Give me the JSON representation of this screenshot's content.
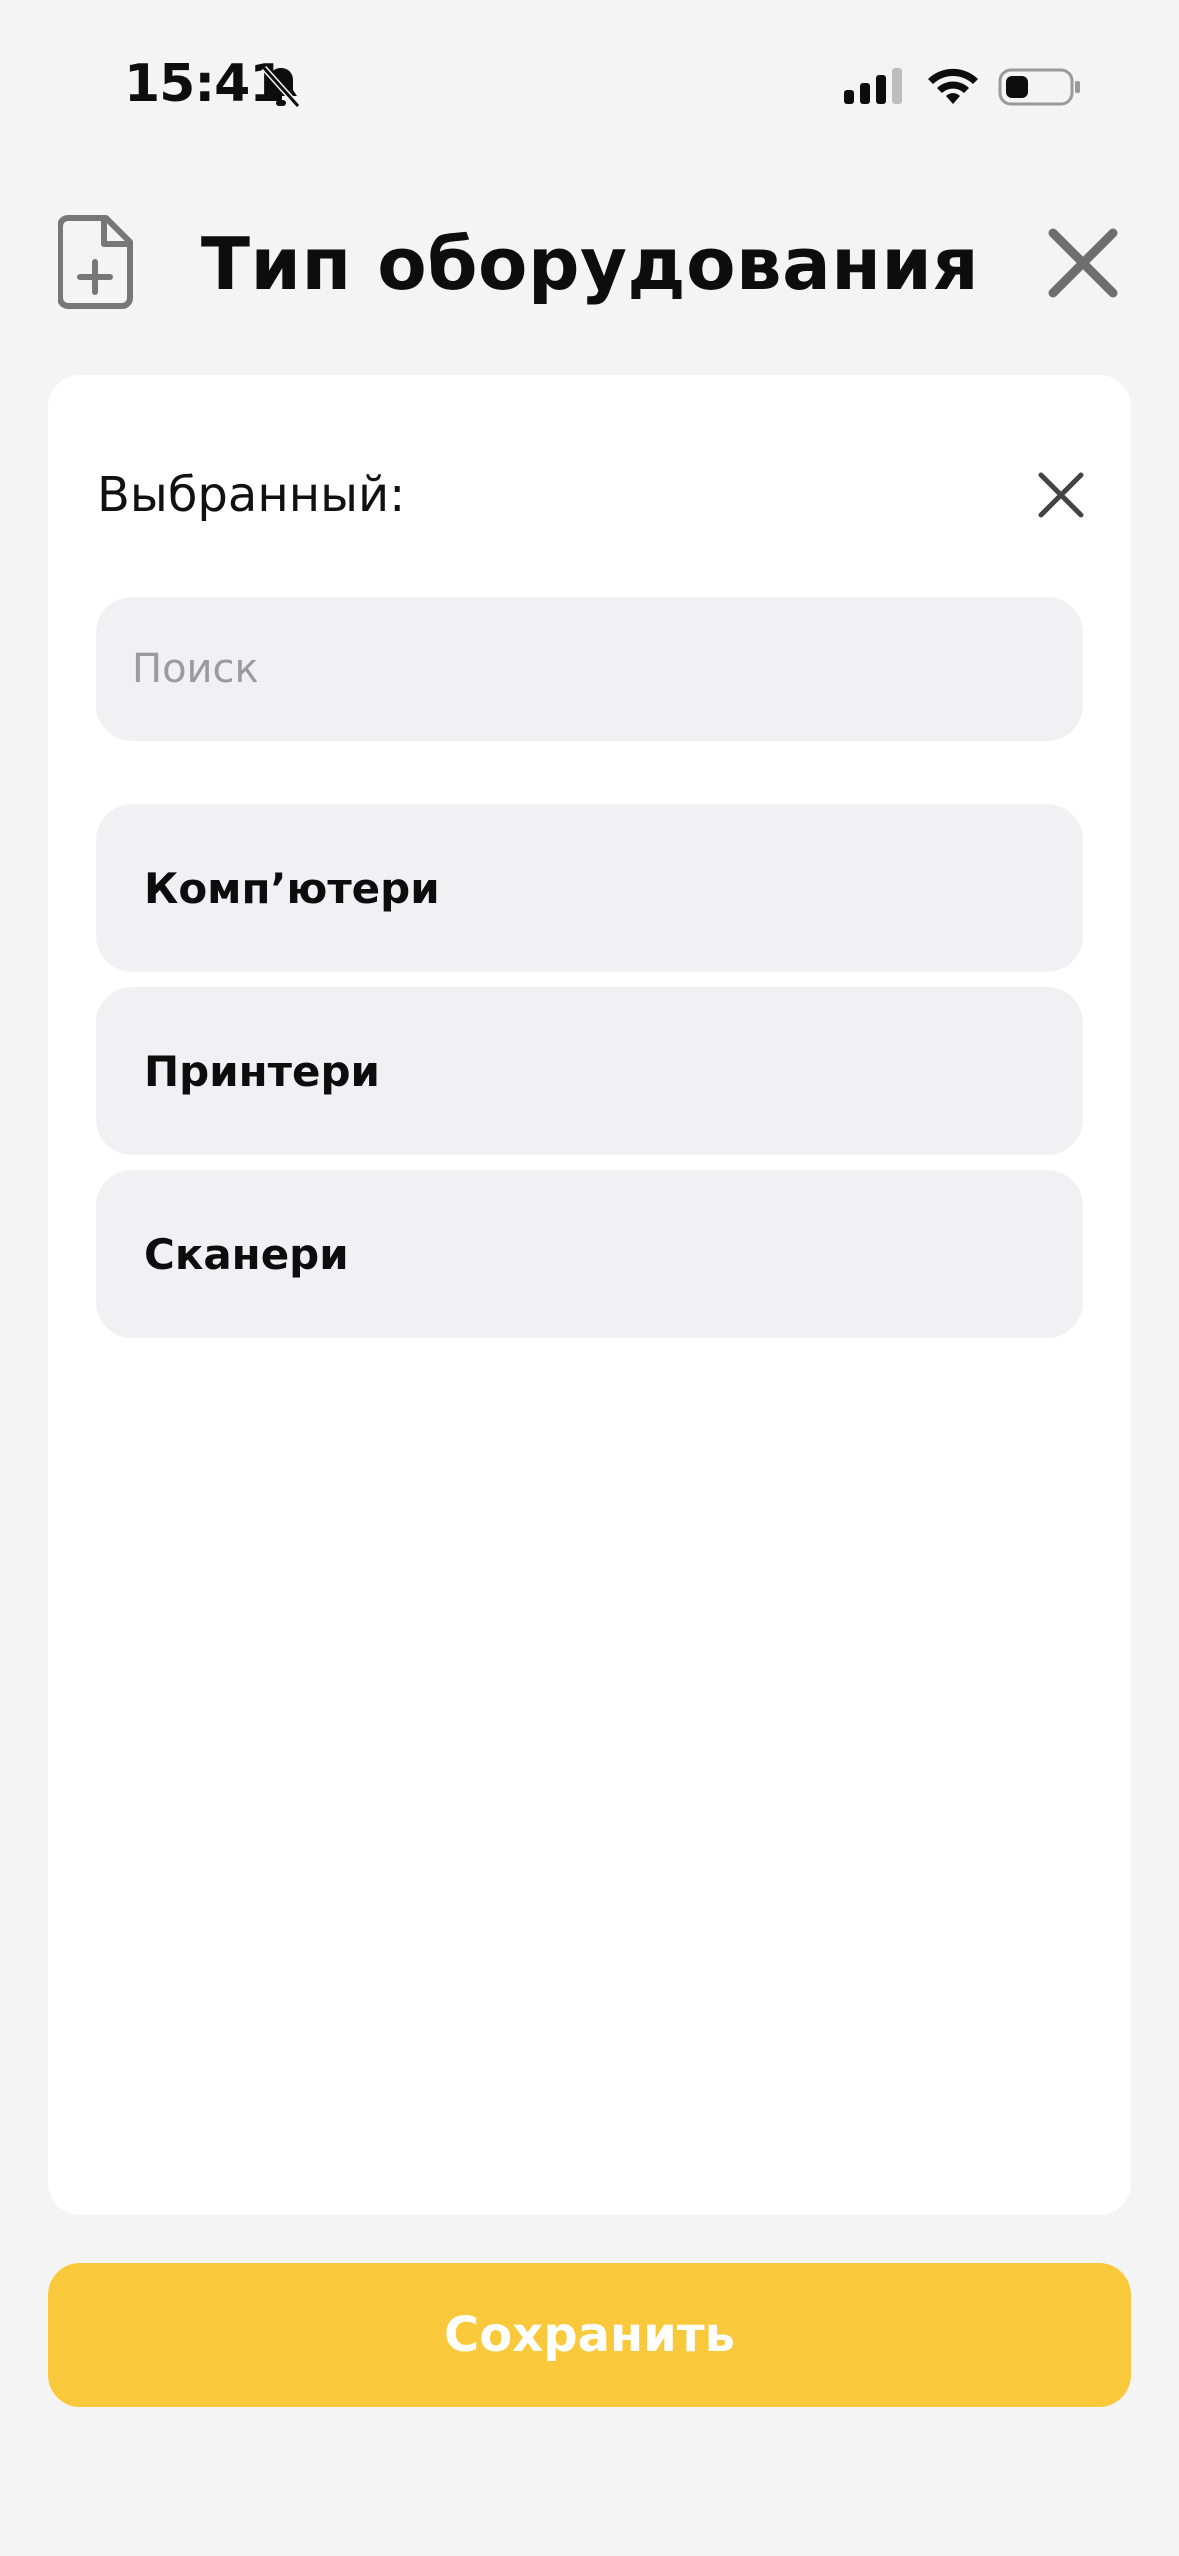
{
  "status_bar": {
    "time": "15:41"
  },
  "header": {
    "title": "Тип оборудования"
  },
  "selection": {
    "label": "Выбранный:"
  },
  "search": {
    "placeholder": "Поиск",
    "value": ""
  },
  "items": [
    {
      "label": "Комп’ютери"
    },
    {
      "label": "Принтери"
    },
    {
      "label": "Сканери"
    }
  ],
  "footer": {
    "save_label": "Сохранить"
  },
  "colors": {
    "accent": "#f9c93b",
    "background": "#f4f4f5",
    "card": "#ffffff",
    "field": "#f1f1f3"
  }
}
